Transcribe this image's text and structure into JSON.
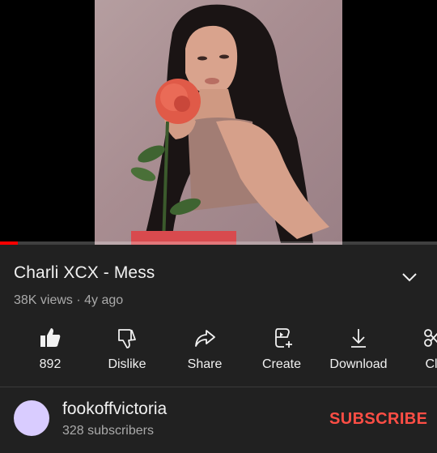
{
  "video": {
    "title": "Charli XCX - Mess",
    "views": "38K views",
    "age": "4y ago",
    "meta_separator": " · ",
    "progress_fraction": 0.04
  },
  "actions": [
    {
      "label": "892",
      "icon": "thumbs-up-filled-icon"
    },
    {
      "label": "Dislike",
      "icon": "thumbs-down-icon"
    },
    {
      "label": "Share",
      "icon": "share-arrow-icon"
    },
    {
      "label": "Create",
      "icon": "create-sparkle-icon"
    },
    {
      "label": "Download",
      "icon": "download-icon"
    },
    {
      "label": "Cl",
      "icon": "clip-scissors-icon"
    }
  ],
  "channel": {
    "name": "fookoffvictoria",
    "subscribers": "328 subscribers",
    "subscribe_label": "SUBSCRIBE",
    "avatar_color": "#d9ccff"
  },
  "colors": {
    "background": "#212121",
    "subscribe": "#ff4e45",
    "progress": "#ff0000"
  }
}
